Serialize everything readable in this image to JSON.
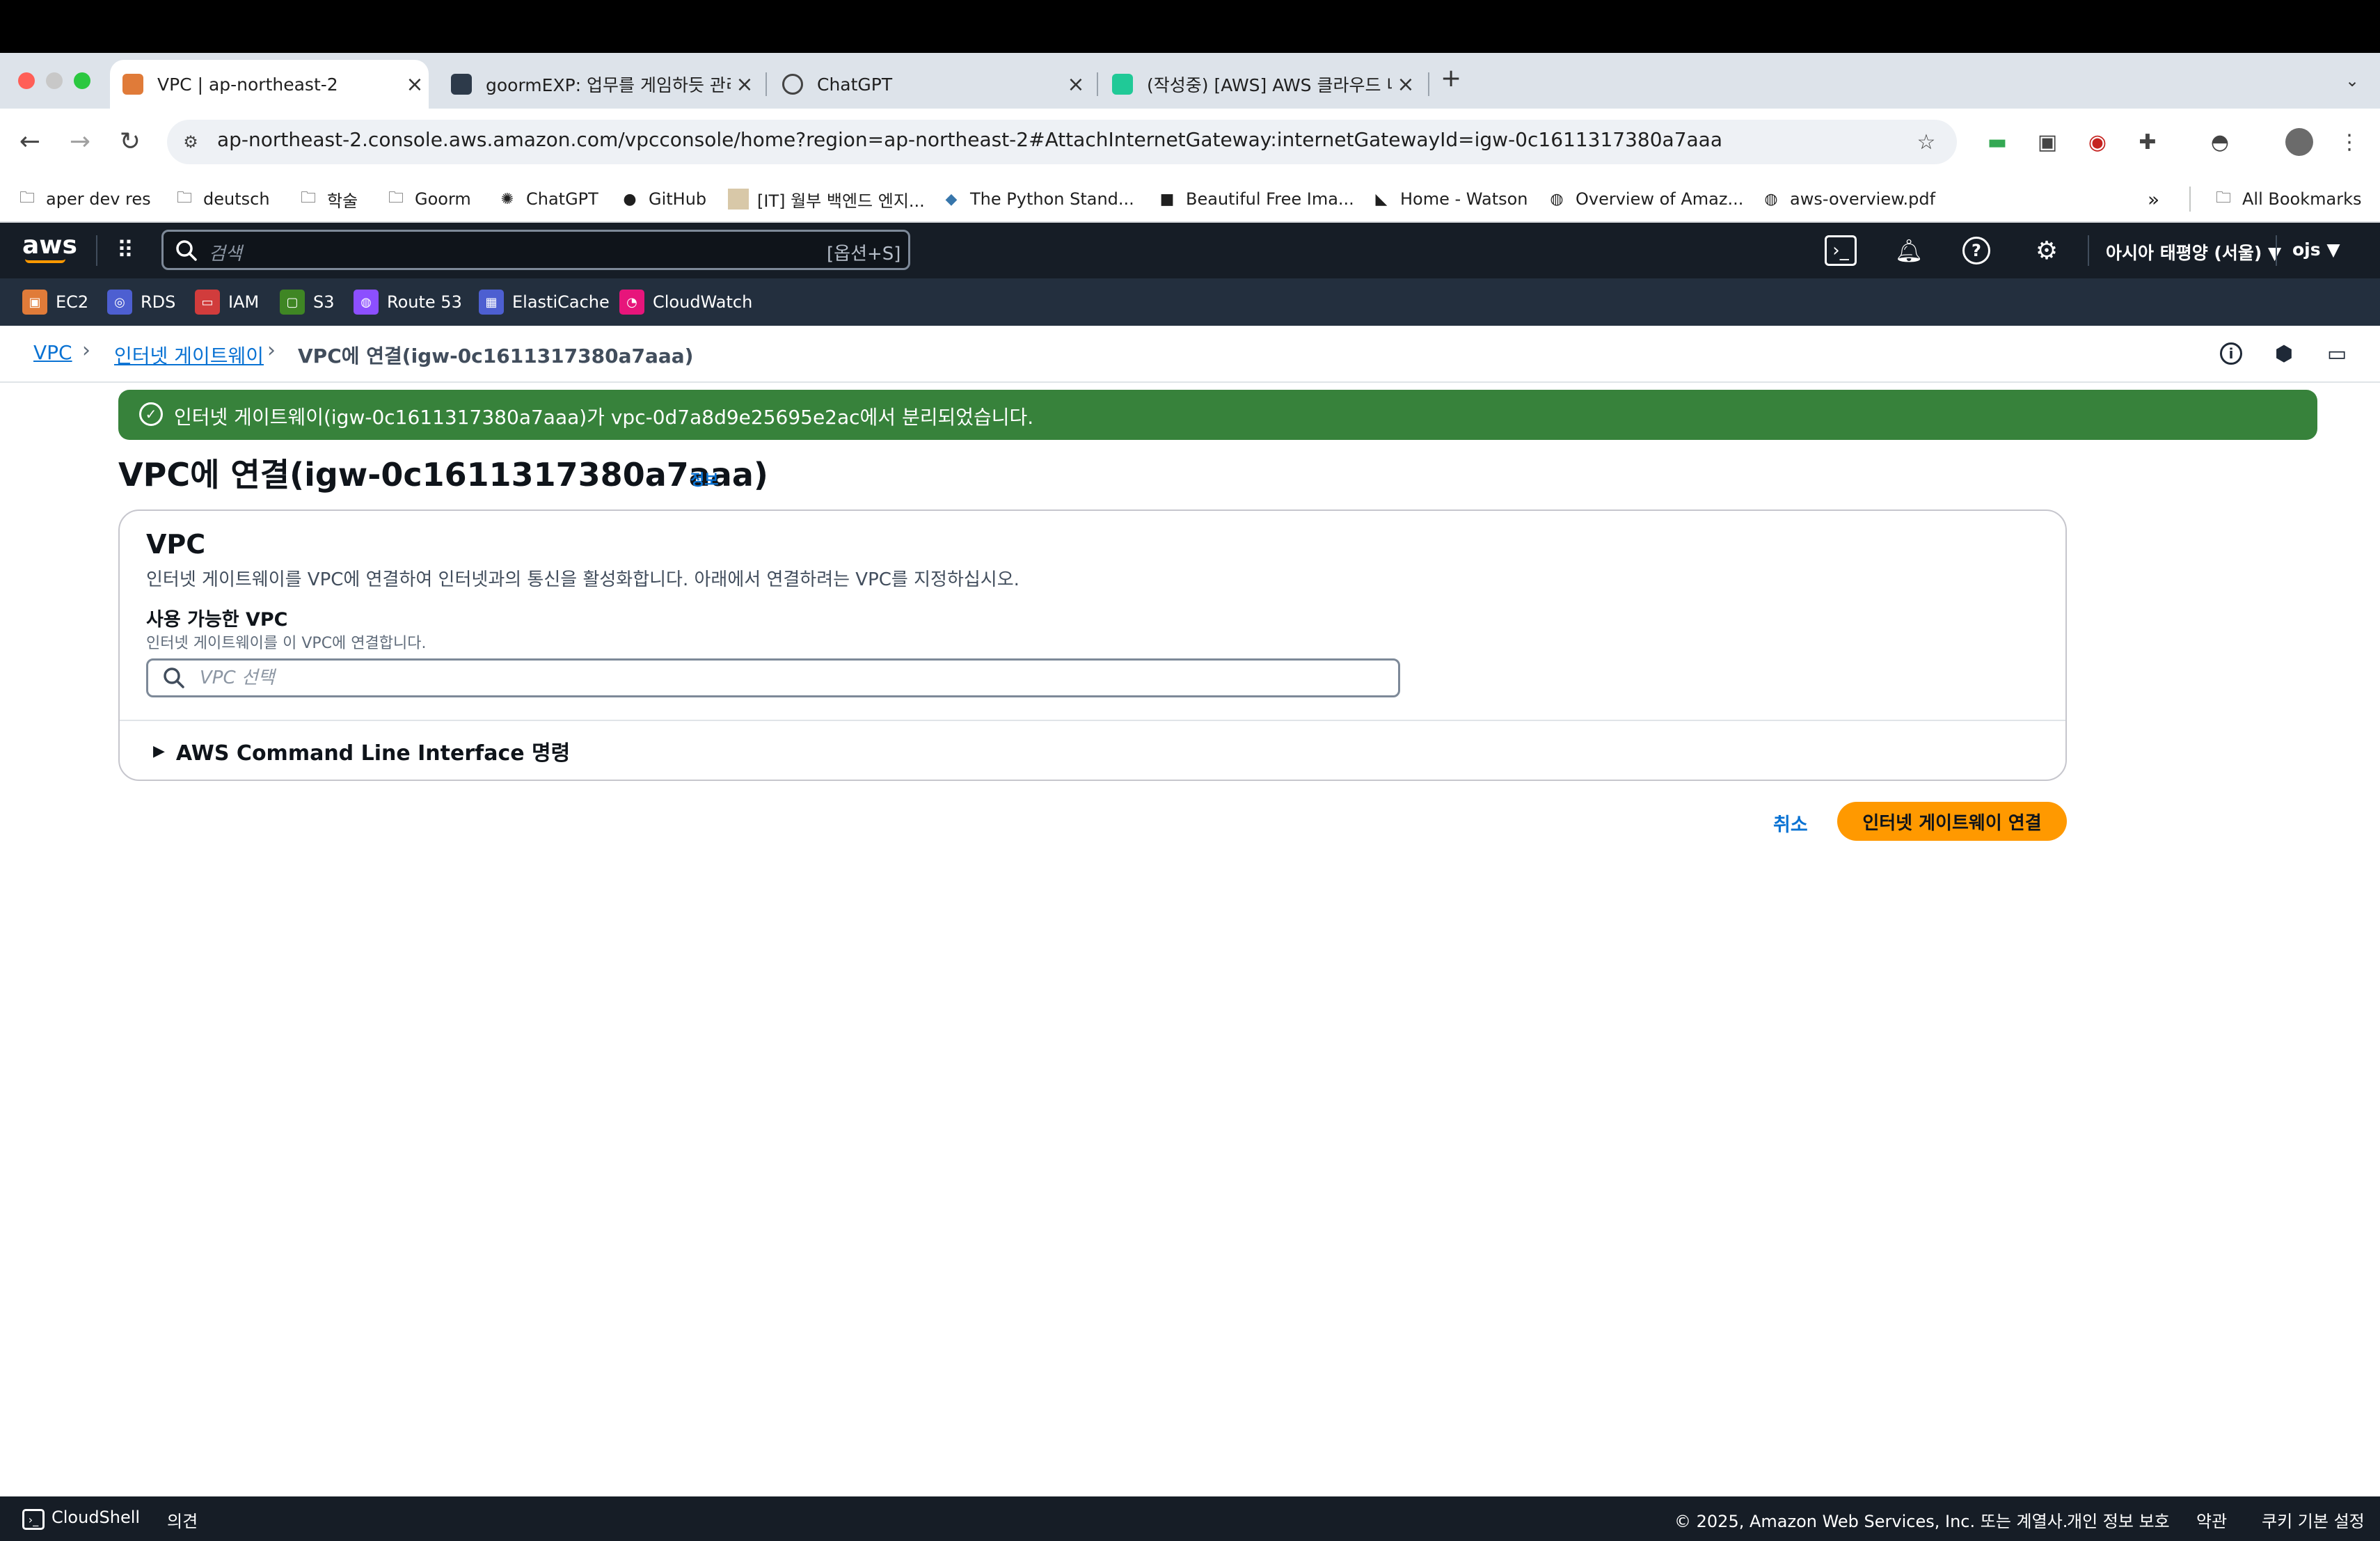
{
  "browser": {
    "tabs": [
      {
        "label": "VPC | ap-northeast-2",
        "active": true
      },
      {
        "label": "goormEXP: 업무를 게임하듯 관리",
        "active": false
      },
      {
        "label": "ChatGPT",
        "active": false
      },
      {
        "label": "(작성중) [AWS] AWS 클라우드 네",
        "active": false
      }
    ],
    "new_tab": "+",
    "url": "ap-northeast-2.console.aws.amazon.com/vpcconsole/home?region=ap-northeast-2#AttachInternetGateway:internetGatewayId=igw-0c1611317380a7aaa",
    "bookmarks": [
      {
        "label": "aper dev res",
        "icon": "folder-icon"
      },
      {
        "label": "deutsch",
        "icon": "folder-icon"
      },
      {
        "label": "학술",
        "icon": "folder-icon"
      },
      {
        "label": "Goorm",
        "icon": "folder-icon"
      },
      {
        "label": "ChatGPT",
        "icon": "openai-icon"
      },
      {
        "label": "GitHub",
        "icon": "github-icon"
      },
      {
        "label": "[IT] 월부 백엔드 엔지...",
        "icon": "bookmark-favicon"
      },
      {
        "label": "The Python Stand...",
        "icon": "python-icon"
      },
      {
        "label": "Beautiful Free Ima...",
        "icon": "unsplash-icon"
      },
      {
        "label": "Home - Watson",
        "icon": "watson-icon"
      },
      {
        "label": "Overview of Amaz...",
        "icon": "globe-icon"
      },
      {
        "label": "aws-overview.pdf",
        "icon": "globe-icon"
      }
    ],
    "more_bookmarks": "»",
    "all_bookmarks": "All Bookmarks"
  },
  "aws": {
    "logo": "aws",
    "search_placeholder": "검색",
    "search_shortcut": "[옵션+S]",
    "region": "아시아 태평양 (서울) ▼",
    "user": "ojs ▼",
    "services": [
      {
        "label": "EC2",
        "color": "#e07b39"
      },
      {
        "label": "RDS",
        "color": "#4d5fd1"
      },
      {
        "label": "IAM",
        "color": "#d13c3c"
      },
      {
        "label": "S3",
        "color": "#3f8624"
      },
      {
        "label": "Route 53",
        "color": "#8c4fff"
      },
      {
        "label": "ElastiCache",
        "color": "#4d5fd1"
      },
      {
        "label": "CloudWatch",
        "color": "#e7157b"
      }
    ]
  },
  "breadcrumb": {
    "items": [
      "VPC",
      "인터넷 게이트웨이"
    ],
    "current": "VPC에 연결(igw-0c1611317380a7aaa)"
  },
  "flash": {
    "message": "인터넷 게이트웨이(igw-0c1611317380a7aaa)가 vpc-0d7a8d9e25695e2ac에서 분리되었습니다.",
    "color": "#37823b"
  },
  "page": {
    "title": "VPC에 연결(igw-0c1611317380a7aaa)",
    "info": "정보"
  },
  "panel": {
    "heading": "VPC",
    "description": "인터넷 게이트웨이를 VPC에 연결하여 인터넷과의 통신을 활성화합니다. 아래에서 연결하려는 VPC를 지정하십시오.",
    "field_label": "사용 가능한 VPC",
    "field_description": "인터넷 게이트웨이를 이 VPC에 연결합니다.",
    "select_placeholder": "VPC 선택",
    "select_value": "",
    "cli_toggle": "AWS Command Line Interface 명령"
  },
  "actions": {
    "cancel": "취소",
    "attach": "인터넷 게이트웨이 연결",
    "attach_color": "#ff9900"
  },
  "footer": {
    "cloudshell": "CloudShell",
    "feedback": "의견",
    "copyright": "© 2025, Amazon Web Services, Inc. 또는 계열사.",
    "privacy": "개인 정보 보호",
    "terms": "약관",
    "cookies": "쿠키 기본 설정"
  }
}
